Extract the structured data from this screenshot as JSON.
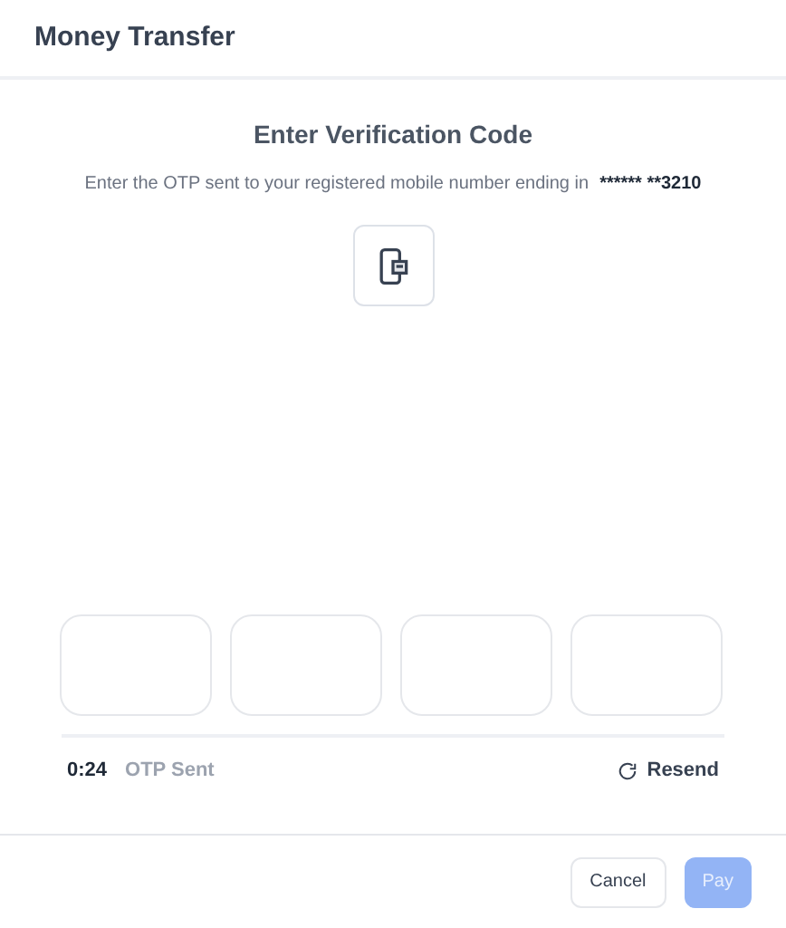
{
  "window": {
    "title": "Money Transfer"
  },
  "heading": "Enter Verification Code",
  "instruction": "Enter the OTP sent to your registered mobile number ending in",
  "masked_number": "****** **3210",
  "otp_fields": [
    {
      "filled": false
    },
    {
      "filled": false
    },
    {
      "filled": false
    },
    {
      "filled": false
    }
  ],
  "timer": "0:24",
  "status": "OTP Sent",
  "resend": "Resend",
  "buttons": [
    {
      "label": "Cancel",
      "kind": "secondary",
      "disabled": false
    },
    {
      "label": "Pay",
      "kind": "primary",
      "disabled": true
    }
  ]
}
